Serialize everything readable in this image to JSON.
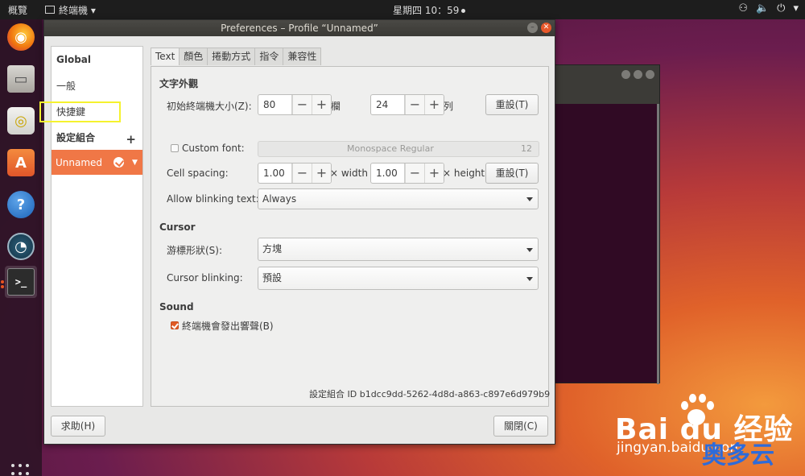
{
  "topbar": {
    "activities": "概覽",
    "app_menu": "終端機 ▾",
    "clock": "星期四 10：59"
  },
  "dock": {
    "items": [
      "firefox-icon",
      "files-icon",
      "rhythmbox-icon",
      "software-icon",
      "help-icon",
      "disk-icon",
      "terminal-icon"
    ]
  },
  "dialog": {
    "title": "Preferences – Profile “Unnamed”",
    "sidebar": {
      "global_heading": "Global",
      "general": "一般",
      "shortcuts": "快捷鍵",
      "profiles_heading": "設定組合",
      "add": "+",
      "selected_profile": "Unnamed"
    },
    "tabs": [
      "Text",
      "顏色",
      "捲動方式",
      "指令",
      "兼容性"
    ],
    "text_tab": {
      "appearance_heading": "文字外觀",
      "initial_size_label": "初始終端機大小(Z):",
      "columns_value": "80",
      "columns_unit": "欄",
      "rows_value": "24",
      "rows_unit": "列",
      "reset_label": "重設(T)",
      "custom_font_label": "Custom font:",
      "font_name": "Monospace Regular",
      "font_size": "12",
      "cell_spacing_label": "Cell spacing:",
      "width_value": "1.00",
      "width_unit": "× width",
      "height_value": "1.00",
      "height_unit": "× height",
      "reset2_label": "重設(T)",
      "blink_text_label": "Allow blinking text:",
      "blink_text_value": "Always",
      "cursor_heading": "Cursor",
      "cursor_shape_label": "游標形狀(S):",
      "cursor_shape_value": "方塊",
      "cursor_blink_label": "Cursor blinking:",
      "cursor_blink_value": "預設",
      "sound_heading": "Sound",
      "bell_label": "終端機會發出響聲(B)",
      "profile_id": "設定組合 ID  b1dcc9dd-5262-4d8d-a863-c897e6d979b9"
    },
    "help_button": "求助(H)",
    "close_button": "關閉(C)"
  },
  "watermark": {
    "logo_text": "Bai du 经验",
    "url_text": "jingyan.baidu.com",
    "overlay_text": "奥多云"
  },
  "colors": {
    "accent": "#f07746",
    "checkbox": "#e05a25",
    "highlight_box": "#f5f22e"
  }
}
